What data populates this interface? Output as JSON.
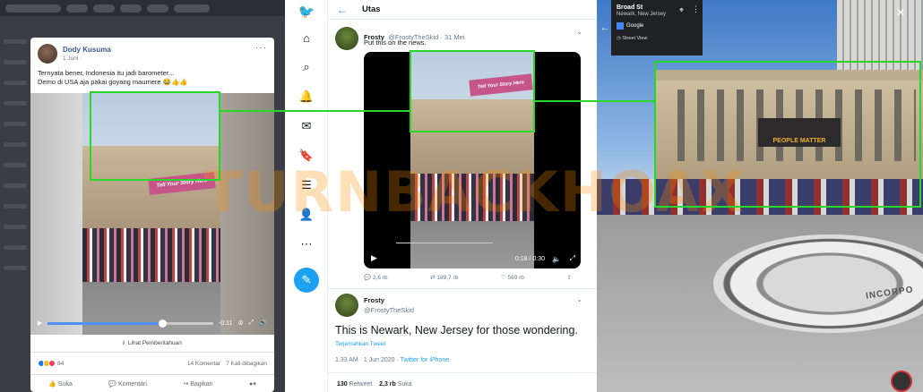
{
  "facebook": {
    "author": "Dody Kusuma",
    "date": "1 Juni ·",
    "more": "···",
    "text_line1": "Ternyata bener, Indonesia itu jadi barometer...",
    "text_line2": "Demo di USA aja pakai goyang maumere 😂👍👍",
    "video_sign": "Tell Your Story Here",
    "video_time": "-0:11",
    "notice": "Lihat Pemberitahuan",
    "reactions_count": "84",
    "comments": "14 Komentar",
    "shares": "7 Kali dibagikan",
    "like_label": "Suka",
    "comment_label": "Komentari",
    "share_label": "Bagikan"
  },
  "twitter": {
    "header_title": "Utas",
    "tweet1": {
      "name": "Frosty",
      "handle": "@FrostyTheSkid · 31 Mei",
      "text": "Put this on the news.",
      "video_time": "0:18 / 0:30",
      "replies": "2,6 rb",
      "retweets": "189,7 rb",
      "likes": "569 rb"
    },
    "tweet2": {
      "name": "Frosty",
      "handle": "@FrostyTheSkid",
      "text": "This is Newark, New Jersey for those wondering.",
      "translate": "Terjemahkan Tweet",
      "time": "1.33 AM · 1 Jun 2020 · ",
      "source": "Twitter for iPhone",
      "retweets_count": "130",
      "retweets_label": "Retweet",
      "likes_count": "2,3 rb",
      "likes_label": "Suka"
    }
  },
  "streetview": {
    "street": "Broad St",
    "city": "Newark, New Jersey",
    "provider": "Google",
    "mode": "Street View",
    "billboard": "PEOPLE MATTER",
    "seal_text": "INCORPO"
  },
  "watermark": "TURNBACKHOAX",
  "colors": {
    "highlight_green": "#28d728",
    "twitter_blue": "#1da1f2",
    "facebook_blue": "#385898"
  }
}
